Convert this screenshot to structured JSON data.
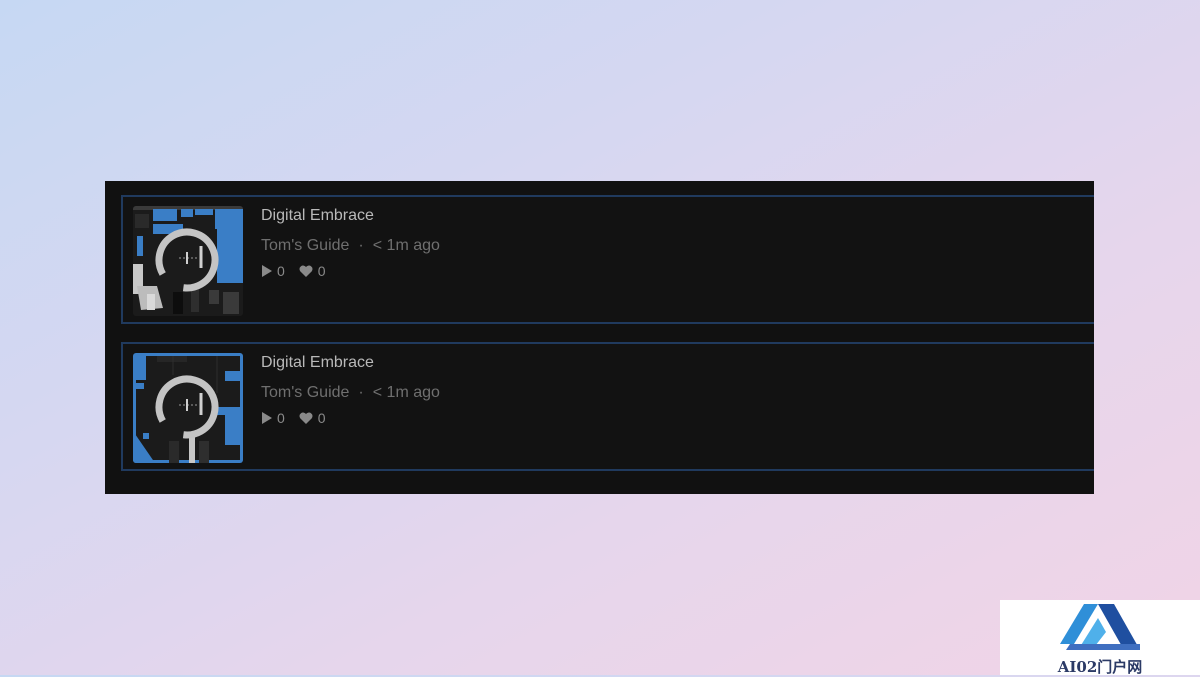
{
  "tracks": [
    {
      "title": "Digital Embrace",
      "author": "Tom's Guide",
      "separator": "·",
      "time": "< 1m ago",
      "plays": "0",
      "likes": "0",
      "selected": false
    },
    {
      "title": "Digital Embrace",
      "author": "Tom's Guide",
      "separator": "·",
      "time": "< 1m ago",
      "plays": "0",
      "likes": "0",
      "selected": true
    }
  ],
  "icons": {
    "play": "play-icon",
    "likes": "heart-icon"
  },
  "watermark": {
    "text": "AI02门户网"
  },
  "colors": {
    "panel_bg": "#111111",
    "track_border": "#203a5e",
    "cover_accent": "#3a7ec6",
    "title_text": "#b9b9b9",
    "meta_text": "#6f6f6f"
  }
}
